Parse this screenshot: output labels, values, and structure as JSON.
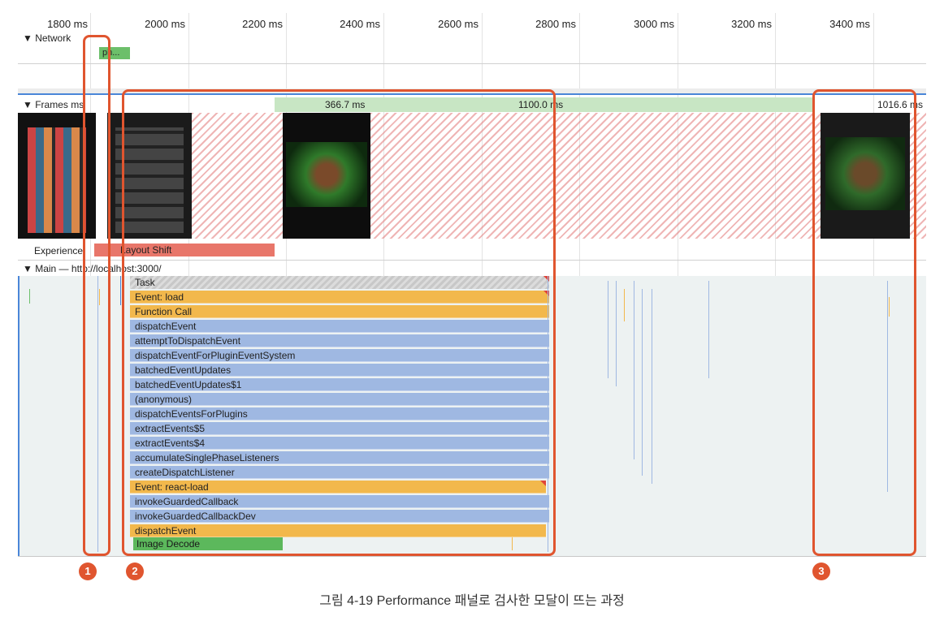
{
  "ruler": {
    "ticks": [
      "1800 ms",
      "2000 ms",
      "2200 ms",
      "2400 ms",
      "2600 ms",
      "2800 ms",
      "3000 ms",
      "3200 ms",
      "3400 ms"
    ]
  },
  "network": {
    "label": "▼ Network",
    "request_label": "ph..."
  },
  "frames": {
    "label": "▼ Frames",
    "unit_fragment": "ms",
    "durations": [
      "366.7 ms",
      "1100.0 ms",
      "1016.6 ms"
    ]
  },
  "experience": {
    "label": "Experience",
    "layout_shift": "Layout Shift"
  },
  "main": {
    "label": "▼ Main — http://localhost:3000/",
    "flame": [
      {
        "label": "Task",
        "kind": "task"
      },
      {
        "label": "Event: load",
        "kind": "orange"
      },
      {
        "label": "Function Call",
        "kind": "orange"
      },
      {
        "label": "dispatchEvent",
        "kind": "blue"
      },
      {
        "label": "attemptToDispatchEvent",
        "kind": "blue"
      },
      {
        "label": "dispatchEventForPluginEventSystem",
        "kind": "blue"
      },
      {
        "label": "batchedEventUpdates",
        "kind": "blue"
      },
      {
        "label": "batchedEventUpdates$1",
        "kind": "blue"
      },
      {
        "label": "(anonymous)",
        "kind": "blue"
      },
      {
        "label": "dispatchEventsForPlugins",
        "kind": "blue"
      },
      {
        "label": "extractEvents$5",
        "kind": "blue"
      },
      {
        "label": "extractEvents$4",
        "kind": "blue"
      },
      {
        "label": "accumulateSinglePhaseListeners",
        "kind": "blue"
      },
      {
        "label": "createDispatchListener",
        "kind": "blue"
      },
      {
        "label": "Event: react-load",
        "kind": "orange"
      },
      {
        "label": "invokeGuardedCallback",
        "kind": "blue"
      },
      {
        "label": "invokeGuardedCallbackDev",
        "kind": "blue"
      },
      {
        "label": "dispatchEvent",
        "kind": "orange"
      }
    ],
    "image_decode": "Image Decode"
  },
  "markers": [
    "1",
    "2",
    "3"
  ],
  "caption": "그림 4-19 Performance 패널로 검사한 모달이 뜨는 과정",
  "colors": {
    "highlight": "#e0552f",
    "layout_shift": "#e8766a",
    "frame_green": "#c8e6c4",
    "image_decode": "#5cb85c"
  }
}
